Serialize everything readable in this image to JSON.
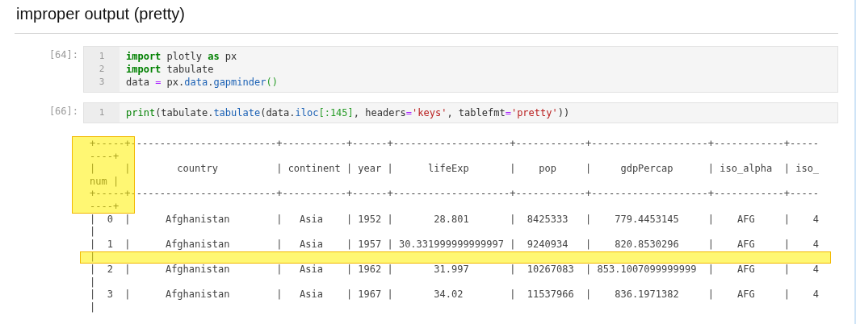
{
  "heading": "improper output (pretty)",
  "cells": [
    {
      "prompt": "[64]:",
      "lines": [
        {
          "number": "1",
          "tokens": [
            {
              "kind": "keyword",
              "text": "import"
            },
            {
              "kind": "plain",
              "text": " plotly "
            },
            {
              "kind": "keyword",
              "text": "as"
            },
            {
              "kind": "plain",
              "text": " px"
            }
          ]
        },
        {
          "number": "2",
          "tokens": [
            {
              "kind": "keyword",
              "text": "import"
            },
            {
              "kind": "plain",
              "text": " tabulate"
            }
          ]
        },
        {
          "number": "3",
          "tokens": [
            {
              "kind": "plain",
              "text": "data "
            },
            {
              "kind": "operator",
              "text": "="
            },
            {
              "kind": "plain",
              "text": " px."
            },
            {
              "kind": "property",
              "text": "data"
            },
            {
              "kind": "plain",
              "text": "."
            },
            {
              "kind": "property",
              "text": "gapminder"
            },
            {
              "kind": "bracket",
              "text": "()"
            }
          ]
        }
      ]
    },
    {
      "prompt": "[66]:",
      "lines": [
        {
          "number": "1",
          "tokens": [
            {
              "kind": "builtin",
              "text": "print"
            },
            {
              "kind": "plain",
              "text": "(tabulate."
            },
            {
              "kind": "property",
              "text": "tabulate"
            },
            {
              "kind": "plain",
              "text": "(data."
            },
            {
              "kind": "property",
              "text": "iloc"
            },
            {
              "kind": "bracket",
              "text": "[:145]"
            },
            {
              "kind": "plain",
              "text": ", headers"
            },
            {
              "kind": "operator",
              "text": "="
            },
            {
              "kind": "string",
              "text": "'keys'"
            },
            {
              "kind": "plain",
              "text": ", tablefmt"
            },
            {
              "kind": "operator",
              "text": "="
            },
            {
              "kind": "string",
              "text": "'pretty'"
            },
            {
              "kind": "plain",
              "text": "))"
            }
          ]
        }
      ],
      "output": [
        "+-----+-------------------------+-----------+------+--------------------+------------+--------------------+------------+-----",
        "----+",
        "|     |        country          | continent | year |      lifeExp       |    pop     |     gdpPercap      | iso_alpha  | iso_",
        "num |",
        "+-----+-------------------------+-----------+------+--------------------+------------+--------------------+------------+-----",
        "----+",
        "|  0  |      Afghanistan        |   Asia    | 1952 |       28.801       |  8425333   |    779.4453145     |    AFG     |    4",
        "|",
        "|  1  |      Afghanistan        |   Asia    | 1957 | 30.331999999999997 |  9240934   |    820.8530296     |    AFG     |    4",
        "|",
        "|  2  |      Afghanistan        |   Asia    | 1962 |       31.997       |  10267083  | 853.1007099999999  |    AFG     |    4",
        "|",
        "|  3  |      Afghanistan        |   Asia    | 1967 |       34.02        |  11537966  |    836.1971382     |    AFG     |    4",
        "|"
      ]
    }
  ]
}
